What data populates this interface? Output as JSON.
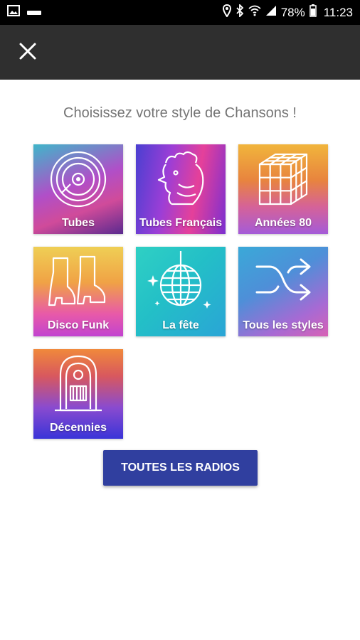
{
  "status_bar": {
    "battery": "78%",
    "time": "11:23",
    "icons": [
      "image-icon",
      "notification-icon",
      "location-icon",
      "bluetooth-icon",
      "wifi-icon",
      "signal-icon",
      "battery-icon"
    ]
  },
  "app_bar": {
    "close_icon": "close-icon"
  },
  "prompt": "Choisissez votre style de Chansons !",
  "styles": [
    {
      "label": "Tubes",
      "icon": "vinyl-record-icon"
    },
    {
      "label": "Tubes Français",
      "icon": "rooster-icon"
    },
    {
      "label": "Années 80",
      "icon": "rubiks-cube-icon"
    },
    {
      "label": "Disco Funk",
      "icon": "platform-boots-icon"
    },
    {
      "label": "La fête",
      "icon": "disco-ball-icon"
    },
    {
      "label": "Tous les styles",
      "icon": "shuffle-icon"
    },
    {
      "label": "Décennies",
      "icon": "jukebox-icon"
    }
  ],
  "radios_button": "TOUTES LES RADIOS"
}
